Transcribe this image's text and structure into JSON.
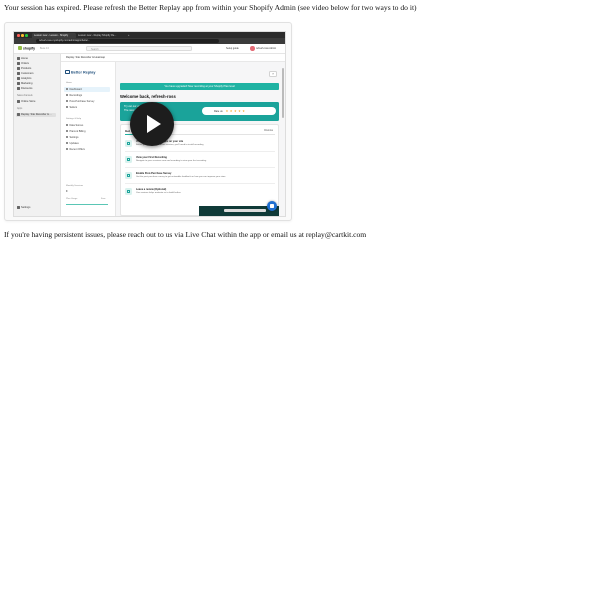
{
  "messages": {
    "expired": "Your session has expired. Please refresh the Better Replay app from within your Shopify Admin (see video below for two ways to do it)",
    "support": "If you're having persistent issues, please reach out to us via Live Chat within the app or email us at replay@cartkit.com"
  },
  "video": {
    "browser": {
      "tabs": [
        "Lesson new - Lesson - Shopify",
        "Lesson new - Replay Shopify Re...",
        "+"
      ],
      "url": "refresh-ross.myshopify.com/admin/apps/better..."
    },
    "shopify": {
      "logo": "shopify",
      "beta": "Beta 4.0",
      "search_placeholder": "Search",
      "setup": "Setup guide",
      "user": "refresh-ross Admin",
      "sidebar": {
        "items": [
          "Home",
          "Orders",
          "Products",
          "Customers",
          "Analytics",
          "Marketing",
          "Discounts"
        ],
        "channels_head": "Sales channels",
        "channels": [
          "Online Store"
        ],
        "apps_head": "Apps",
        "apps": [
          "Replay: Site Recorder & ..."
        ],
        "settings": "Settings"
      }
    },
    "app": {
      "strip_title": "Replay: Site Recorder & Heatmap",
      "logo": "Better Replay",
      "nav_head_main": "Home",
      "nav": [
        "Dashboard",
        "Recordings",
        "Post-Purchase Survey",
        "Sellers"
      ],
      "nav_head_settings": "Settings & Help",
      "nav2": [
        "Data Sorces",
        "Plans & Billing",
        "Settings",
        "Updates",
        "Recent Offers"
      ],
      "monthly_sessions_label": "Monthly Sessions",
      "monthly_sessions_value": "0",
      "plan_label": "Plan Usage",
      "plan_value": "Free"
    },
    "main": {
      "help": "?",
      "banner": "You have upgraded! Now recording at your Shopify Plan level",
      "welcome": "Welcome back, refresh-ross",
      "promo_line1": "Try out our upgraded Replay tab",
      "promo_line2": "The new way to see Better Replay",
      "rate": "Rate us",
      "stars": "★★★★★",
      "card_title": "Get started",
      "card_dismiss": "Dismiss",
      "tasks": [
        {
          "title": "Visit a few recording pages on your site",
          "desc": "Before you can replay a visitor session, you'll need to install recording"
        },
        {
          "title": "View your First Recording",
          "desc": "Navigate to your sessions area and recording to view your first recording"
        },
        {
          "title": "Enable Post-Purchase Survey",
          "desc": "Get the post-purchase survey to get actionable feedback on how you can improve your store"
        },
        {
          "title": "Leave a review (Optional)",
          "desc": "Your reviews helps motivate us to build further"
        }
      ]
    }
  }
}
